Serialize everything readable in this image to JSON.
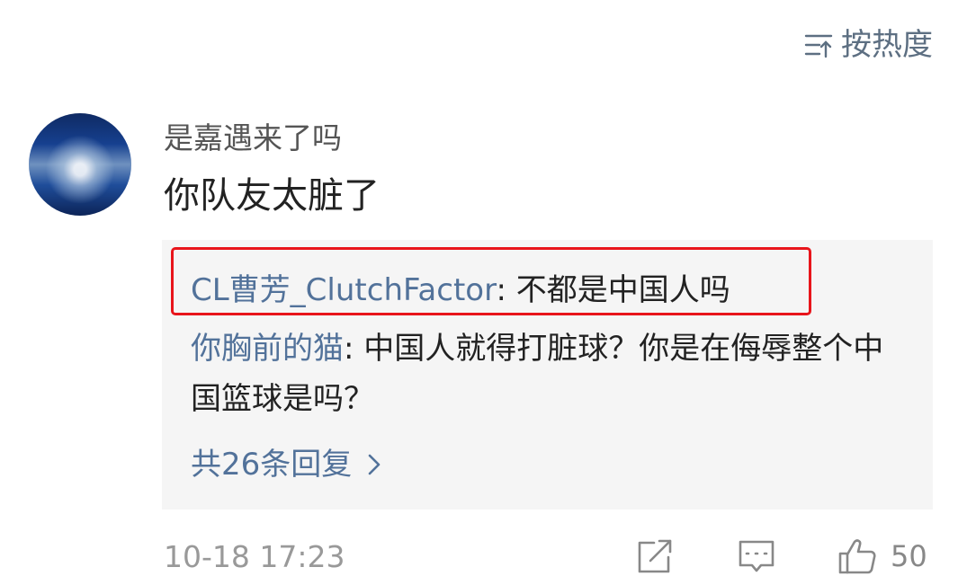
{
  "sort": {
    "label": "按热度",
    "icon": "sort-icon"
  },
  "comment": {
    "username": "是嘉遇来了吗",
    "text": "你队友太脏了",
    "timestamp": "10-18 17:23",
    "like_count": "50"
  },
  "replies": [
    {
      "name": "CL曹芳_ClutchFactor",
      "text": ": 不都是中国人吗"
    },
    {
      "name": "你胸前的猫",
      "text": ": 中国人就得打脏球？你是在侮辱整个中国篮球是吗？"
    }
  ],
  "more_replies_label": "共26条回复",
  "colors": {
    "link": "#52729a",
    "highlight_border": "#e8151b",
    "reply_bg": "#f5f5f5",
    "icon_gray": "#888888"
  }
}
